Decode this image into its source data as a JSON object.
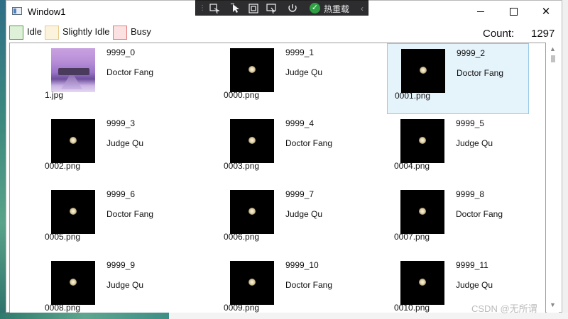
{
  "window": {
    "title": "Window1",
    "minimize_glyph": "",
    "close_glyph": "✕"
  },
  "debug_toolbar": {
    "grip": "⋮",
    "icons": [
      "select-element-icon",
      "pointer-icon",
      "frame-icon",
      "layout-icon",
      "refresh-icon"
    ],
    "hot_reload_label": "热重载",
    "collapse_glyph": "‹"
  },
  "legend": [
    {
      "label": "Idle",
      "fill": "#dff0d8",
      "border": "#4f9a4f"
    },
    {
      "label": "Slightly Idle",
      "fill": "#fcf3dc",
      "border": "#e6c98d"
    },
    {
      "label": "Busy",
      "fill": "#fbe1e1",
      "border": "#e37b7b"
    }
  ],
  "count": {
    "label": "Count:",
    "value": "1297"
  },
  "items": [
    {
      "id": "9999_0",
      "name": "Doctor Fang",
      "file": "1.jpg",
      "thumb": "photo",
      "selected": false
    },
    {
      "id": "9999_1",
      "name": "Judge Qu",
      "file": "0000.png",
      "thumb": "seed",
      "selected": false
    },
    {
      "id": "9999_2",
      "name": "Doctor Fang",
      "file": "0001.png",
      "thumb": "seed",
      "selected": true
    },
    {
      "id": "9999_3",
      "name": "Judge Qu",
      "file": "0002.png",
      "thumb": "seed",
      "selected": false
    },
    {
      "id": "9999_4",
      "name": "Doctor Fang",
      "file": "0003.png",
      "thumb": "seed",
      "selected": false
    },
    {
      "id": "9999_5",
      "name": "Judge Qu",
      "file": "0004.png",
      "thumb": "seed",
      "selected": false
    },
    {
      "id": "9999_6",
      "name": "Doctor Fang",
      "file": "0005.png",
      "thumb": "seed",
      "selected": false
    },
    {
      "id": "9999_7",
      "name": "Judge Qu",
      "file": "0006.png",
      "thumb": "seed",
      "selected": false
    },
    {
      "id": "9999_8",
      "name": "Doctor Fang",
      "file": "0007.png",
      "thumb": "seed",
      "selected": false
    },
    {
      "id": "9999_9",
      "name": "Judge Qu",
      "file": "0008.png",
      "thumb": "seed",
      "selected": false
    },
    {
      "id": "9999_10",
      "name": "Doctor Fang",
      "file": "0009.png",
      "thumb": "seed",
      "selected": false
    },
    {
      "id": "9999_11",
      "name": "Judge Qu",
      "file": "0010.png",
      "thumb": "seed",
      "selected": false
    }
  ],
  "scrollbar": {
    "up_glyph": "▲",
    "down_glyph": "▼"
  },
  "watermark": "CSDN @无所谓"
}
